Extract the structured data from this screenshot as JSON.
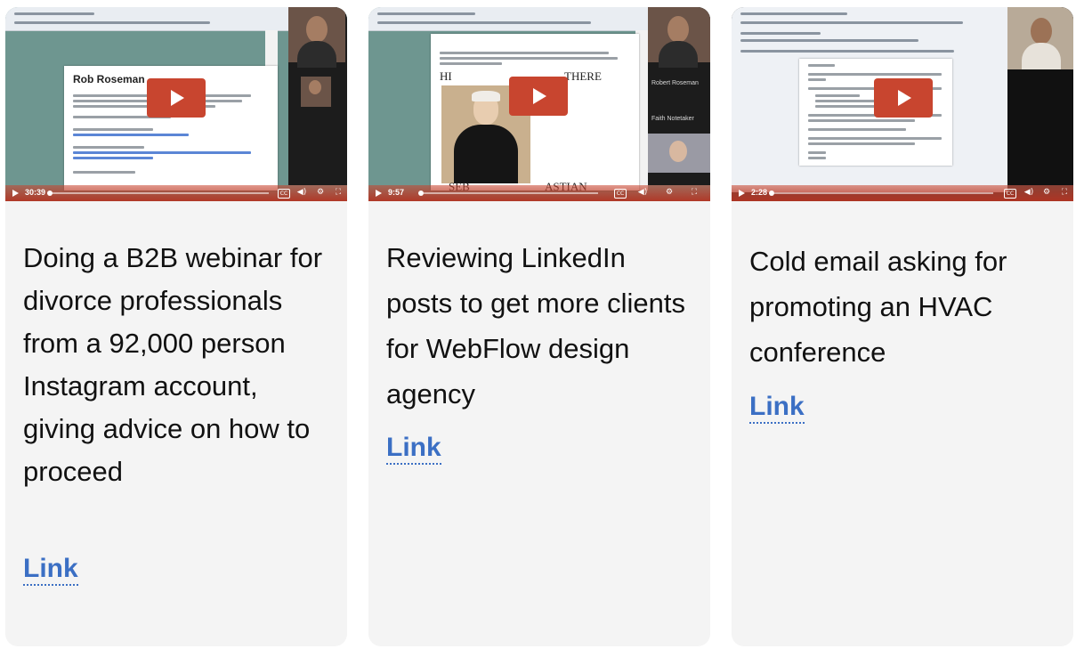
{
  "cards": [
    {
      "video": {
        "time": "30:39"
      },
      "description": "Doing a B2B webinar for divorce professionals from a 92,000 person Instagram account, giving advice on how to proceed",
      "link_label": "Link"
    },
    {
      "video": {
        "time": "9:57"
      },
      "description": "Reviewing LinkedIn posts to get more clients for WebFlow design agency",
      "link_label": "Link"
    },
    {
      "video": {
        "time": "2:28"
      },
      "description": "Cold email asking for promoting an HVAC conference",
      "link_label": "Link"
    }
  ],
  "video_controls": {
    "play_icon": "play-icon",
    "cc_icon": "closed-captions-icon",
    "volume_icon": "volume-icon",
    "settings_icon": "settings-gear-icon",
    "fullscreen_icon": "fullscreen-icon",
    "cc_label": "CC"
  },
  "colors": {
    "play_button": "#c8452f",
    "link": "#3b6fc4",
    "card_background": "#f4f4f4"
  }
}
